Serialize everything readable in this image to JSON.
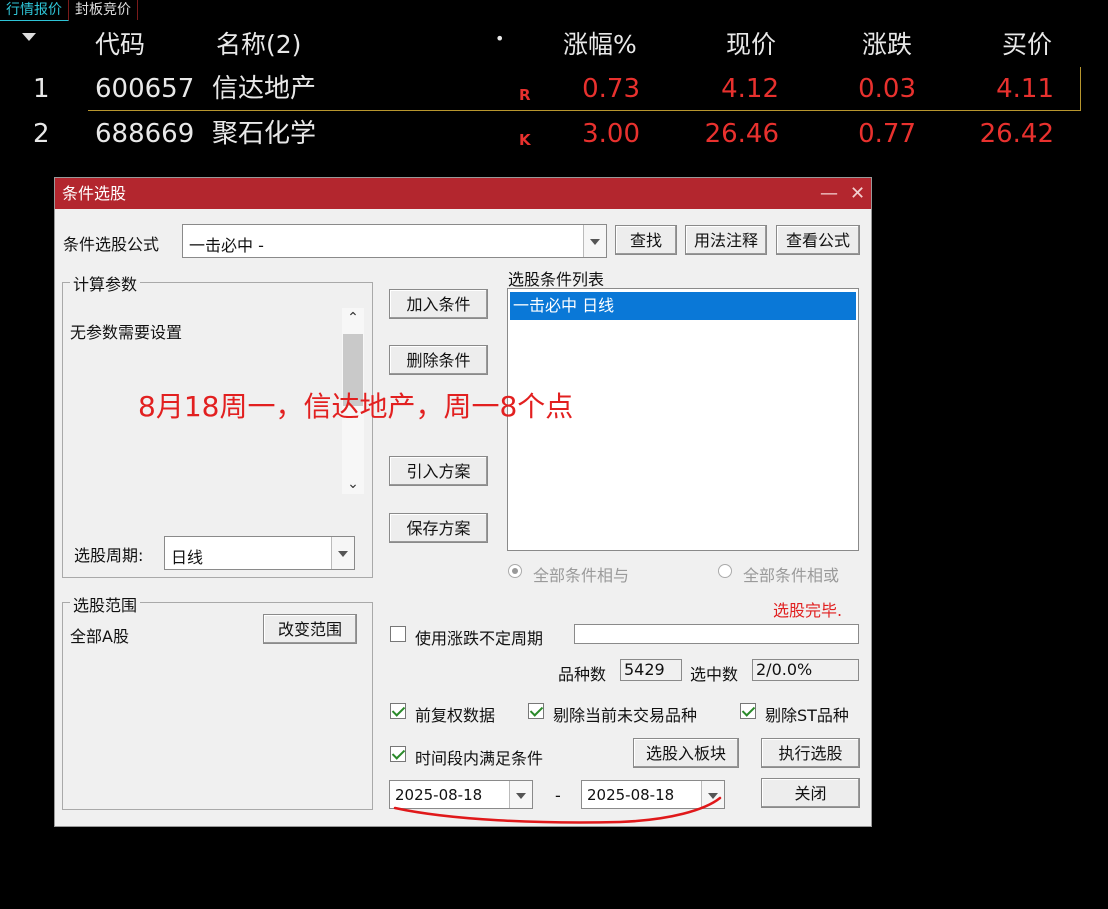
{
  "tabs": [
    "行情报价",
    "封板竞价"
  ],
  "table": {
    "headers": [
      "代码",
      "名称(2)",
      "•",
      "涨幅%",
      "现价",
      "涨跌",
      "买价"
    ],
    "rows": [
      {
        "idx": "1",
        "code": "600657",
        "name": "信达地产",
        "flag": "R",
        "pct": "0.73",
        "price": "4.12",
        "change": "0.03",
        "bid": "4.11"
      },
      {
        "idx": "2",
        "code": "688669",
        "name": "聚石化学",
        "flag": "K",
        "pct": "3.00",
        "price": "26.46",
        "change": "0.77",
        "bid": "26.42"
      }
    ]
  },
  "dialog": {
    "title": "条件选股",
    "minimize": "—",
    "close": "✕",
    "formula_label": "条件选股公式",
    "formula_value": "一击必中  -",
    "btn_find": "查找",
    "btn_usage": "用法注释",
    "btn_view": "查看公式",
    "params_group": "计算参数",
    "params_text": "无参数需要设置",
    "period_label": "选股周期:",
    "period_value": "日线",
    "btn_add": "加入条件",
    "btn_delete": "删除条件",
    "btn_import": "引入方案",
    "btn_save": "保存方案",
    "list_label": "选股条件列表",
    "list_items": [
      "一击必中  日线"
    ],
    "radio_and": "全部条件相与",
    "radio_or": "全部条件相或",
    "status": "选股完毕.",
    "range_group": "选股范围",
    "range_value": "全部A股",
    "btn_change_range": "改变范围",
    "uncertain_period": "使用涨跌不定周期",
    "count_label": "品种数",
    "count_value": "5429",
    "selected_label": "选中数",
    "selected_value": "2/0.0%",
    "cb_adjust": "前复权数据",
    "cb_exclude_nontrade": "剔除当前未交易品种",
    "cb_exclude_st": "剔除ST品种",
    "cb_period_condition": "时间段内满足条件",
    "btn_to_block": "选股入板块",
    "btn_execute": "执行选股",
    "date_from": "2025-08-18",
    "date_sep": "-",
    "date_to": "2025-08-18",
    "btn_close": "关闭"
  },
  "annotation": "8月18周一，信达地产，周一8个点",
  "colors": {
    "title_bar": "#b3262e",
    "up_red": "#e8312e",
    "tab_active": "#2ec4d6",
    "annotation": "#e22020"
  }
}
